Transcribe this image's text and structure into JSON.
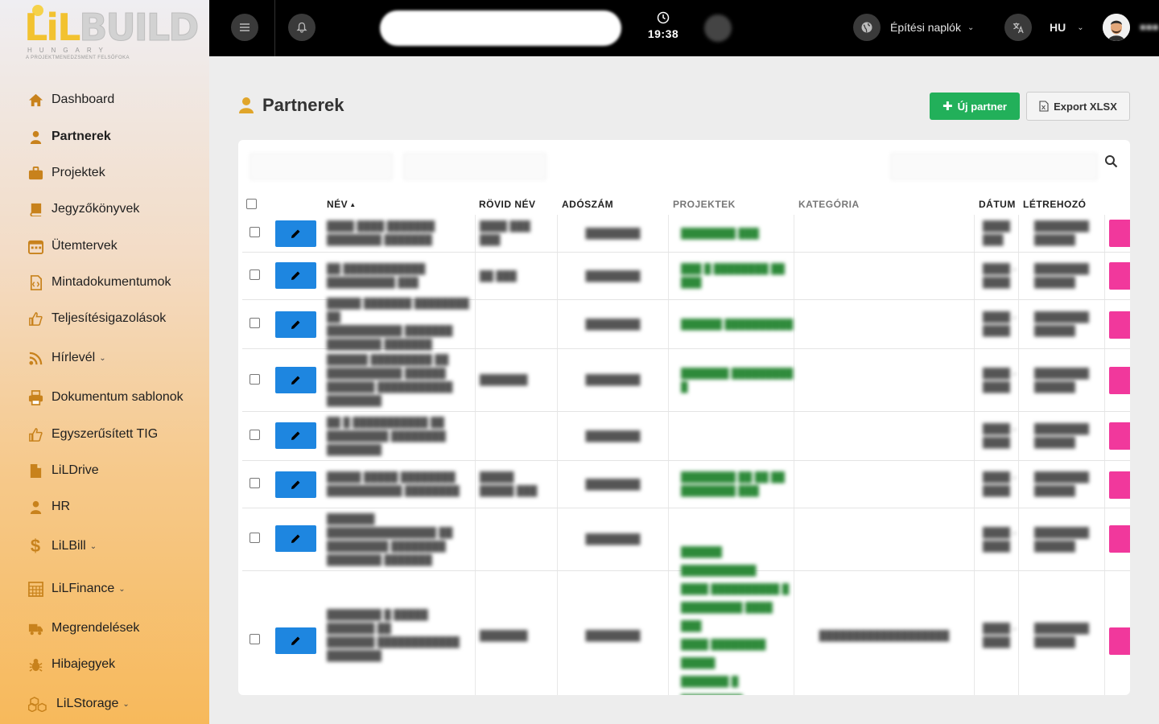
{
  "logo": {
    "lil": "LiL",
    "build": "BUILD",
    "sub1": "HUNGARY",
    "sub2": "A PROJEKTMENEDZSMENT FELSŐFOKA"
  },
  "sidebar": {
    "items": [
      {
        "label": "Dashboard",
        "icon": "home-icon"
      },
      {
        "label": "Partnerek",
        "icon": "user-icon",
        "active": true
      },
      {
        "label": "Projektek",
        "icon": "briefcase-icon"
      },
      {
        "label": "Jegyzőkönyvek",
        "icon": "book-icon"
      },
      {
        "label": "Ütemtervek",
        "icon": "calendar-icon"
      },
      {
        "label": "Mintadokumentumok",
        "icon": "file-code-icon"
      },
      {
        "label": "Teljesítésigazolások",
        "icon": "thumbs-up-icon"
      },
      {
        "label": "Hírlevél",
        "icon": "rss-icon",
        "caret": true
      },
      {
        "label": "Dokumentum sablonok",
        "icon": "printer-icon"
      },
      {
        "label": "Egyszerűsített TIG",
        "icon": "thumbs-up-icon"
      },
      {
        "label": "LiLDrive",
        "icon": "file-icon"
      },
      {
        "label": "HR",
        "icon": "user-icon"
      },
      {
        "label": "LiLBill",
        "icon": "dollar-icon",
        "caret": true
      },
      {
        "label": "LiLFinance",
        "icon": "calculator-icon",
        "caret": true
      },
      {
        "label": "Megrendelések",
        "icon": "truck-icon"
      },
      {
        "label": "Hibajegyek",
        "icon": "bug-icon"
      },
      {
        "label": "LiLStorage",
        "icon": "cubes-icon",
        "caret": true
      }
    ]
  },
  "topbar": {
    "time": "19:38",
    "diary_label": "Építési naplók",
    "lang": "HU",
    "caret": "⌄"
  },
  "page": {
    "title": "Partnerek",
    "new_button": "Új partner",
    "export_button": "Export XLSX"
  },
  "table": {
    "columns": [
      "NÉV",
      "RÖVID NÉV",
      "ADÓSZÁM",
      "PROJEKTEK",
      "KATEGÓRIA",
      "DÁTUM",
      "LÉTREHOZÓ"
    ],
    "sort_indicator": "▲"
  }
}
